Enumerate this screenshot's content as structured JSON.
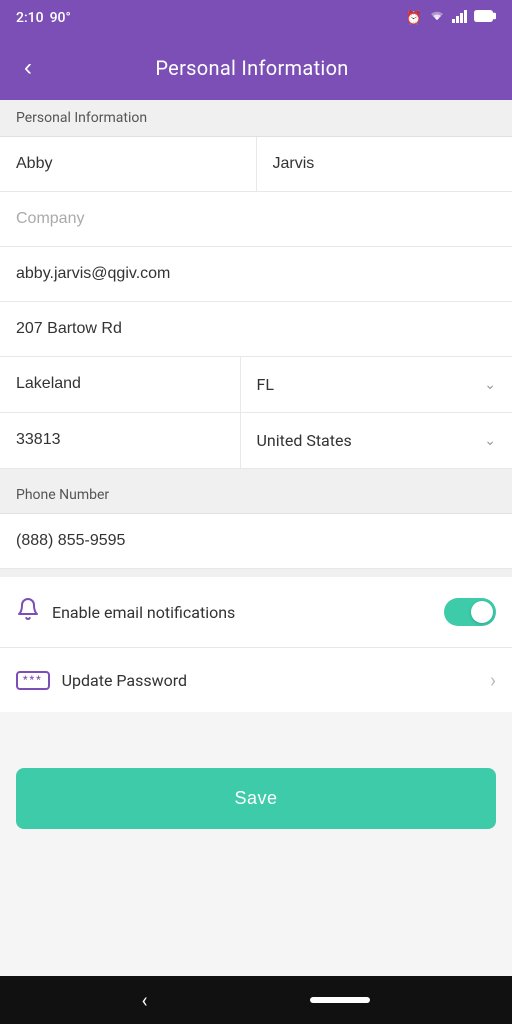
{
  "status": {
    "time": "2:10",
    "temperature": "90°",
    "alarm_icon": "⏰",
    "wifi_icon": "▼",
    "signal_icon": "▲",
    "battery_icon": "🔋"
  },
  "header": {
    "title": "Personal Information",
    "back_icon": "‹"
  },
  "form": {
    "section_label": "Personal Information",
    "first_name": "Abby",
    "last_name": "Jarvis",
    "company_placeholder": "Company",
    "email": "abby.jarvis@qgiv.com",
    "address": "207 Bartow Rd",
    "city": "Lakeland",
    "state": "FL",
    "zip": "33813",
    "country": "United States",
    "phone_section_label": "Phone Number",
    "phone": "(888) 855-9595"
  },
  "notifications": {
    "label": "Enable email notifications",
    "enabled": true
  },
  "update_password": {
    "label": "Update Password"
  },
  "actions": {
    "save_label": "Save"
  },
  "nav": {
    "back_icon": "‹"
  }
}
